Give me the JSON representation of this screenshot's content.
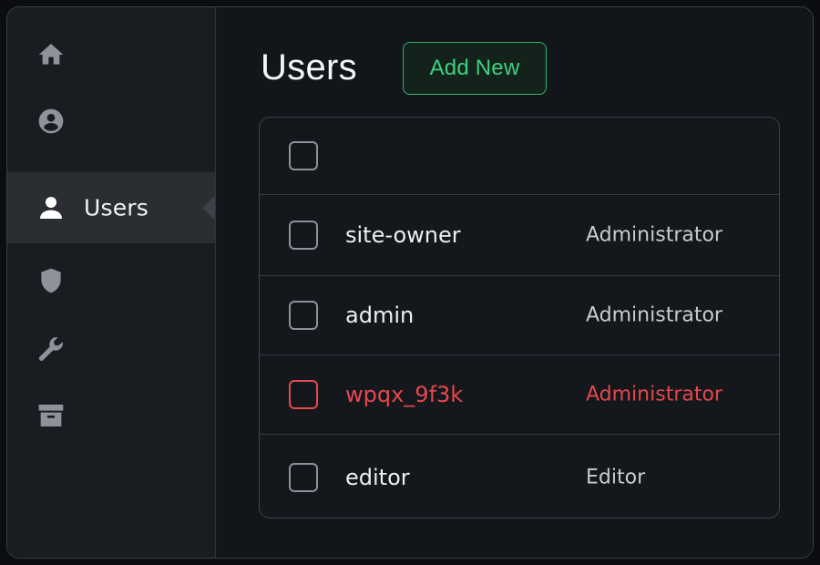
{
  "sidebar": {
    "items": [
      {
        "id": "home",
        "icon": "home-icon",
        "label": "",
        "active": false
      },
      {
        "id": "profile",
        "icon": "user-circle-icon",
        "label": "",
        "active": false
      },
      {
        "id": "users",
        "icon": "user-icon",
        "label": "Users",
        "active": true
      },
      {
        "id": "security",
        "icon": "shield-icon",
        "label": "",
        "active": false
      },
      {
        "id": "tools",
        "icon": "wrench-icon",
        "label": "",
        "active": false
      },
      {
        "id": "archive",
        "icon": "archive-icon",
        "label": "",
        "active": false
      }
    ]
  },
  "main": {
    "title": "Users",
    "add_button_label": "Add New"
  },
  "table": {
    "rows": [
      {
        "username": "site-owner",
        "role": "Administrator",
        "highlighted": false
      },
      {
        "username": "admin",
        "role": "Administrator",
        "highlighted": false
      },
      {
        "username": "wpqx_9f3k",
        "role": "Administrator",
        "highlighted": true
      },
      {
        "username": "editor",
        "role": "Editor",
        "highlighted": false
      }
    ]
  },
  "colors": {
    "accent_green": "#3fd07f",
    "danger_red": "#e5484d",
    "background": "#12151a",
    "sidebar_active": "#2a2d32"
  }
}
